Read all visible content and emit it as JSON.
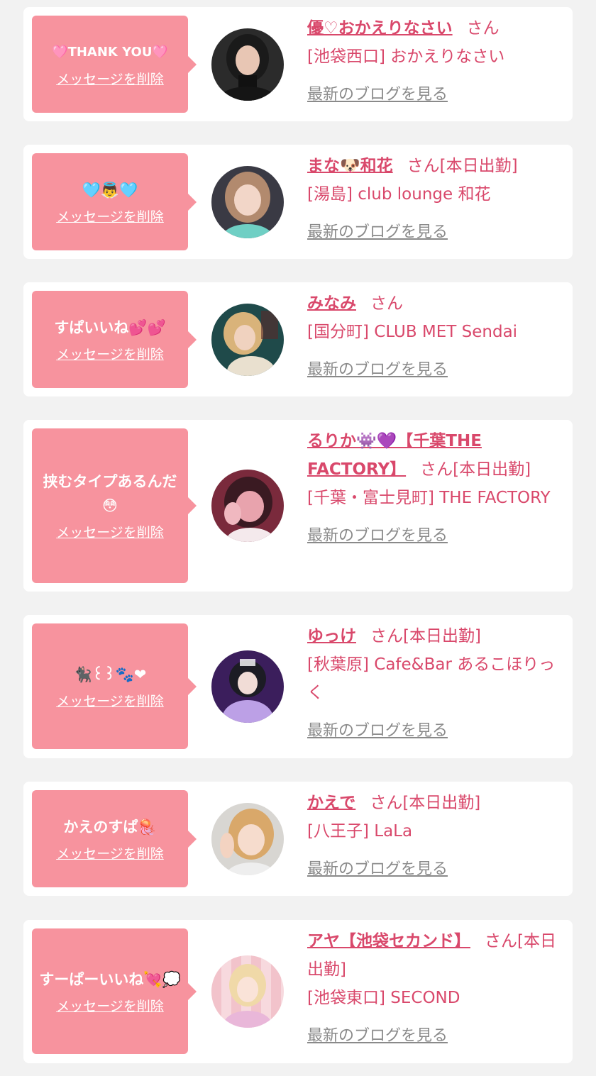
{
  "common": {
    "delete_label": "メッセージを削除",
    "blog_label": "最新のブログを見る"
  },
  "colors": {
    "bubble": "#f7939e",
    "accent": "#d9486b",
    "link_gray": "#8a8a8a",
    "background": "#f2f2f2"
  },
  "items": [
    {
      "message": "🩷THANK YOU🩷",
      "name": "優♡おかえりなさい",
      "suffix": "さん",
      "location": "[池袋西口] おかえりなさい",
      "avatar_icon": "avatar-dark-hair-woman"
    },
    {
      "message": "🩵👼🩵",
      "name": "まな🐶和花",
      "suffix": "さん[本日出勤]",
      "location": "[湯島] club lounge 和花",
      "avatar_icon": "avatar-light-hair-woman"
    },
    {
      "message": "すぱいいね💕💕",
      "name": "みなみ",
      "suffix": "さん",
      "location": "[国分町] CLUB MET Sendai",
      "avatar_icon": "avatar-blonde-woman"
    },
    {
      "message": "挟むタイプあるんだ😳",
      "name": "るりか👾💜【千葉THE FACTORY】",
      "suffix": "さん[本日出勤]",
      "location": "[千葉・富士見町] THE FACTORY",
      "avatar_icon": "avatar-pink-selfie"
    },
    {
      "message": "🐈‍⬛꒰꒱🐾❤",
      "name": "ゆっけ",
      "suffix": "さん[本日出勤]",
      "location": "[秋葉原] Cafe&Bar あるこほりっく",
      "avatar_icon": "avatar-purple-costume"
    },
    {
      "message": "かえのすぱ🪼",
      "name": "かえで",
      "suffix": "さん[本日出勤]",
      "location": "[八王子] LaLa",
      "avatar_icon": "avatar-peace-sign"
    },
    {
      "message": "すーぱーいいね💘💭",
      "name": "アヤ【池袋セカンド】",
      "suffix": "さん[本日出勤]",
      "location": "[池袋東口] SECOND",
      "avatar_icon": "avatar-pink-background"
    }
  ]
}
